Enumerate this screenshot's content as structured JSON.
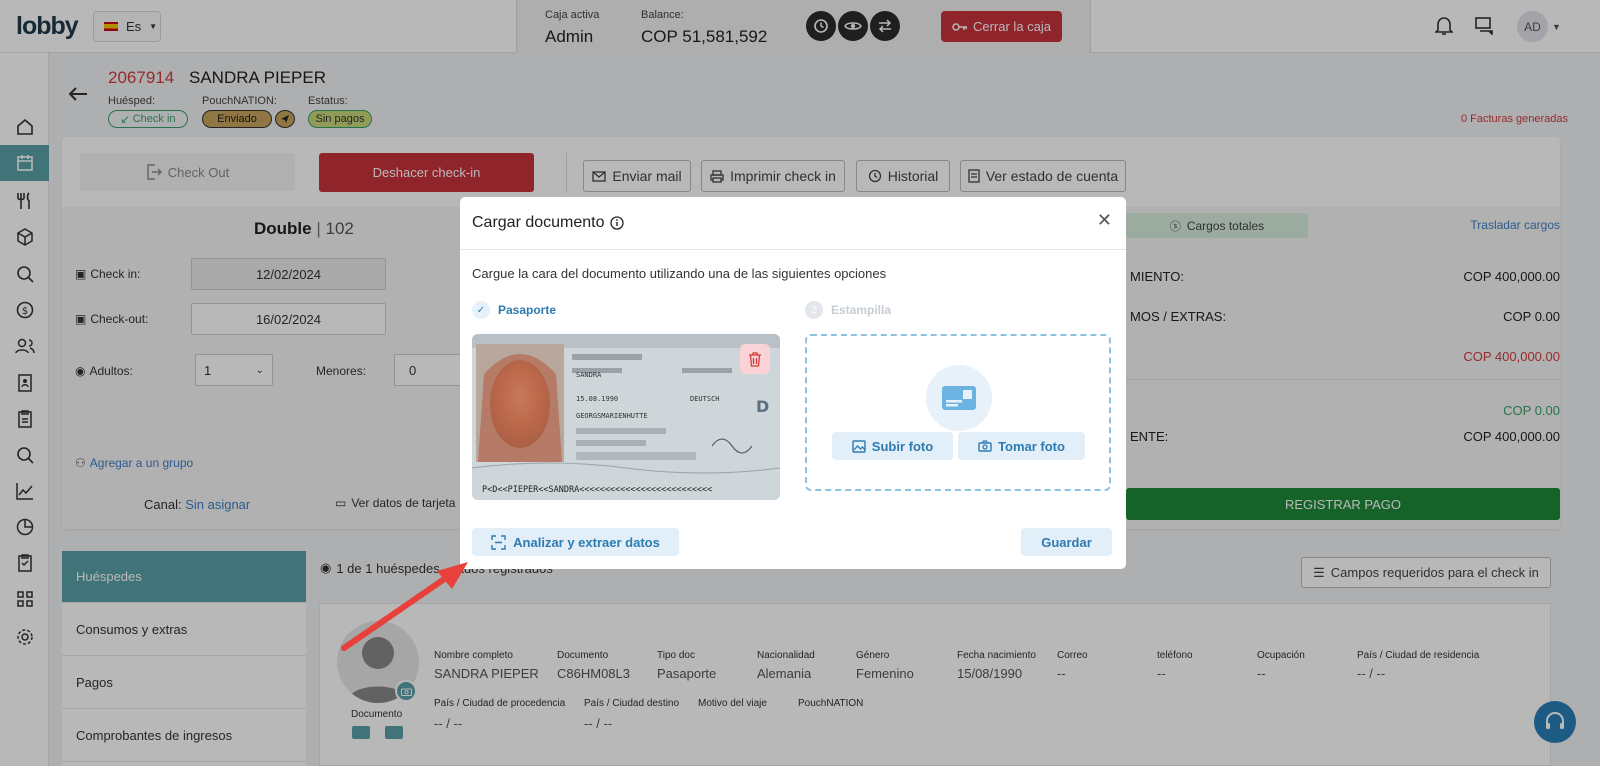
{
  "topbar": {
    "logo": "lobby",
    "language": "Es",
    "caja_label": "Caja activa",
    "caja_value": "Admin",
    "balance_label": "Balance:",
    "balance_value": "COP 51,581,592",
    "close_box_label": "Cerrar la caja",
    "avatar_initials": "AD"
  },
  "reservation": {
    "number": "2067914",
    "guest_name": "SANDRA PIEPER",
    "huesped_label": "Huésped:",
    "huesped_status": "Check in",
    "pouch_label": "PouchNATION:",
    "pouch_status": "Enviado",
    "estatus_label": "Estatus:",
    "estatus_status": "Sin pagos",
    "facturas": "0 Facturas generadas"
  },
  "actions": {
    "check_out": "Check Out",
    "undo_checkin": "Deshacer check-in",
    "send_mail": "Enviar mail",
    "print_checkin": "Imprimir check in",
    "history": "Historial",
    "account_status": "Ver estado de cuenta"
  },
  "room": {
    "type": "Double",
    "separator": " | ",
    "number": "102",
    "checkin_label": "Check in:",
    "checkin_value": "12/02/2024",
    "checkout_label": "Check-out:",
    "checkout_value": "16/02/2024",
    "adults_label": "Adultos:",
    "adults_value": "1",
    "minors_label": "Menores:",
    "minors_value": "0",
    "group_link": "Agregar a un grupo",
    "canal_label": "Canal:",
    "canal_value": "Sin asignar",
    "card_data": "Ver datos de tarjeta"
  },
  "summary": {
    "cargos_label": "Cargos totales",
    "trasladar": "Trasladar cargos",
    "row1_label": "MIENTO:",
    "row1_value": "COP 400,000.00",
    "row2_label": "MOS / EXTRAS:",
    "row2_value": "COP 0.00",
    "row3_value": "COP 400,000.00",
    "row4_value": "COP 0.00",
    "row5_label": "ENTE:",
    "row5_value": "COP 400,000.00",
    "register_payment": "REGISTRAR PAGO"
  },
  "tabs": [
    {
      "label": "Huéspedes"
    },
    {
      "label": "Consumos y extras"
    },
    {
      "label": "Pagos"
    },
    {
      "label": "Comprobantes de ingresos"
    }
  ],
  "guests": {
    "count_text": "1 de 1 huéspedes",
    "count_suffix": "ados registrados",
    "required_fields": "Campos requeridos para el check in",
    "document_label": "Documento",
    "columns": [
      {
        "label": "Nombre completo",
        "value": "SANDRA PIEPER"
      },
      {
        "label": "Documento",
        "value": "C86HM08L3"
      },
      {
        "label": "Tipo doc",
        "value": "Pasaporte"
      },
      {
        "label": "Nacionalidad",
        "value": "Alemania"
      },
      {
        "label": "Género",
        "value": "Femenino"
      },
      {
        "label": "Fecha nacimiento",
        "value": "15/08/1990"
      },
      {
        "label": "Correo",
        "value": "--"
      },
      {
        "label": "teléfono",
        "value": "--"
      },
      {
        "label": "Ocupación",
        "value": "--"
      },
      {
        "label": "País / Ciudad de residencia",
        "value": "-- / --"
      }
    ],
    "columns2": [
      {
        "label": "País / Ciudad de procedencia",
        "value": "-- / --"
      },
      {
        "label": "País / Ciudad destino",
        "value": "-- / --"
      },
      {
        "label": "Motivo del viaje",
        "value": ""
      },
      {
        "label": "PouchNATION",
        "value": ""
      }
    ]
  },
  "modal": {
    "title": "Cargar documento",
    "instructions": "Cargue la cara del documento utilizando una de las siguientes opciones",
    "step1_label": "Pasaporte",
    "step2_number": "2",
    "step2_label": "Estampilla",
    "passport_name": "SANDRA",
    "passport_dob": "15.08.1990",
    "passport_nationality": "DEUTSCH",
    "passport_place": "GEORGSMARIENHUTTE",
    "passport_mrz": "P<D<<PIEPER<<SANDRA<<<<<<<<<<<<<<<<<<<<<<<<<<",
    "upload_photo": "Subir foto",
    "take_photo": "Tomar foto",
    "analyze": "Analizar y extraer datos",
    "save": "Guardar"
  },
  "colors": {
    "brand_red": "#c8323c",
    "teal": "#5aa1a8",
    "green": "#1f8a3a",
    "light_blue": "#2e7bb1",
    "arrow_red": "#e8403a"
  }
}
